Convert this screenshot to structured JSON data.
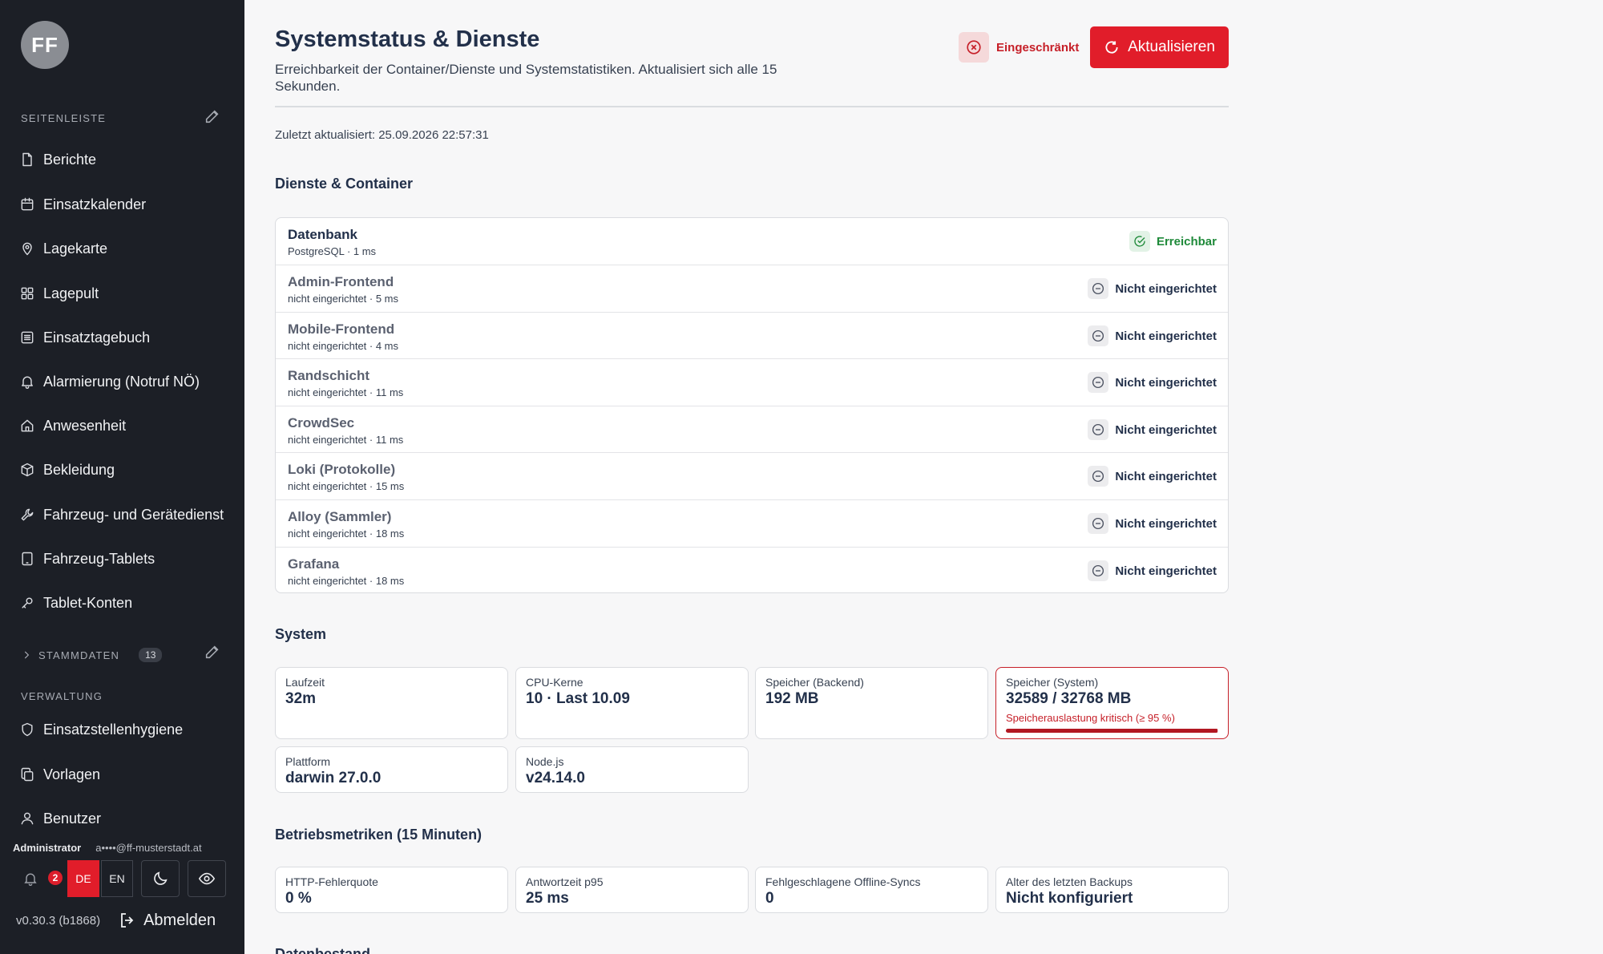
{
  "sidebar": {
    "avatar_initials": "FF",
    "section_label": "SEITENLEISTE",
    "items": [
      {
        "label": "Berichte",
        "icon": "file-icon"
      },
      {
        "label": "Einsatzkalender",
        "icon": "calendar-icon"
      },
      {
        "label": "Lagekarte",
        "icon": "map-pin-icon"
      },
      {
        "label": "Lagepult",
        "icon": "grid-icon"
      },
      {
        "label": "Einsatztagebuch",
        "icon": "list-icon"
      },
      {
        "label": "Alarmierung (Notruf NÖ)",
        "icon": "bell-icon"
      },
      {
        "label": "Anwesenheit",
        "icon": "home-icon"
      },
      {
        "label": "Bekleidung",
        "icon": "box-icon"
      },
      {
        "label": "Fahrzeug- und Gerätedienst",
        "icon": "wrench-icon"
      },
      {
        "label": "Fahrzeug-Tablets",
        "icon": "tablet-icon"
      },
      {
        "label": "Tablet-Konten",
        "icon": "key-icon"
      }
    ],
    "stammdaten_label": "STAMMDATEN",
    "stammdaten_count": "13",
    "verwaltung_label": "VERWALTUNG",
    "verwaltung_items": [
      {
        "label": "Einsatzstellenhygiene",
        "icon": "shield-icon"
      },
      {
        "label": "Vorlagen",
        "icon": "copy-icon"
      },
      {
        "label": "Benutzer",
        "icon": "user-icon"
      }
    ],
    "user": {
      "role": "Administrator",
      "email": "a••••@ff-musterstadt.at"
    },
    "notifications": "2",
    "lang_de": "DE",
    "lang_en": "EN",
    "version": "v0.30.3 (b1868)",
    "logout": "Abmelden"
  },
  "header": {
    "title": "Systemstatus & Dienste",
    "subtitle": "Erreichbarkeit der Container/Dienste und Systemstatistiken. Aktualisiert sich alle 15 Sekunden.",
    "status": "Eingeschränkt",
    "refresh": "Aktualisieren",
    "last_updated": "Zuletzt aktualisiert: 25.09.2026 22:57:31"
  },
  "services": {
    "heading": "Dienste & Container",
    "rows": [
      {
        "name": "Datenbank",
        "meta": "PostgreSQL · 1 ms",
        "status": "Erreichbar"
      },
      {
        "name": "Admin-Frontend",
        "meta": "nicht eingerichtet · 5 ms",
        "status": "Nicht eingerichtet"
      },
      {
        "name": "Mobile-Frontend",
        "meta": "nicht eingerichtet · 4 ms",
        "status": "Nicht eingerichtet"
      },
      {
        "name": "Randschicht",
        "meta": "nicht eingerichtet · 11 ms",
        "status": "Nicht eingerichtet"
      },
      {
        "name": "CrowdSec",
        "meta": "nicht eingerichtet · 11 ms",
        "status": "Nicht eingerichtet"
      },
      {
        "name": "Loki (Protokolle)",
        "meta": "nicht eingerichtet · 15 ms",
        "status": "Nicht eingerichtet"
      },
      {
        "name": "Alloy (Sammler)",
        "meta": "nicht eingerichtet · 18 ms",
        "status": "Nicht eingerichtet"
      },
      {
        "name": "Grafana",
        "meta": "nicht eingerichtet · 18 ms",
        "status": "Nicht eingerichtet"
      }
    ]
  },
  "system": {
    "heading": "System",
    "cards": [
      {
        "label": "Laufzeit",
        "value": "32m"
      },
      {
        "label": "CPU-Kerne",
        "value": "10 · Last 10.09"
      },
      {
        "label": "Speicher (Backend)",
        "value": "192 MB"
      },
      {
        "label": "Speicher (System)",
        "value": "32589 / 32768 MB",
        "warning": "Speicherauslastung kritisch (≥ 95 %)",
        "usage_fraction": 0.9945
      },
      {
        "label": "Plattform",
        "value": "darwin 27.0.0"
      },
      {
        "label": "Node.js",
        "value": "v24.14.0"
      }
    ]
  },
  "metrics": {
    "heading": "Betriebsmetriken (15 Minuten)",
    "cards": [
      {
        "label": "HTTP-Fehlerquote",
        "value": "0 %"
      },
      {
        "label": "Antwortzeit p95",
        "value": "25 ms"
      },
      {
        "label": "Fehlgeschlagene Offline-Syncs",
        "value": "0"
      },
      {
        "label": "Alter des letzten Backups",
        "value": "Nicht konfiguriert"
      }
    ]
  },
  "next_section": "Datenbestand"
}
